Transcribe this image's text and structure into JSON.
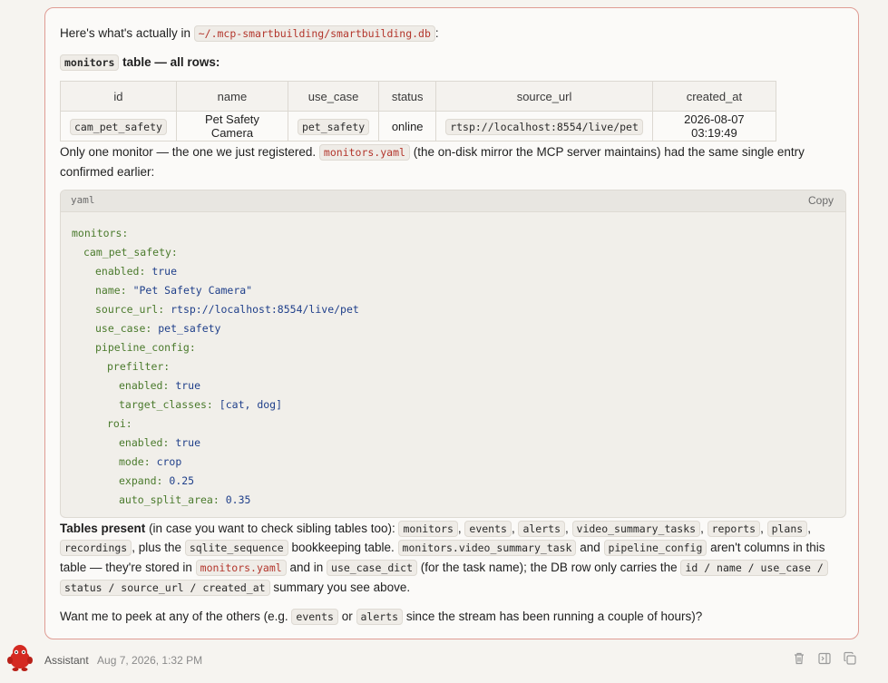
{
  "message": {
    "intro_text": "Here's what's actually in",
    "db_path": "~/.mcp-smartbuilding/smartbuilding.db",
    "colon": ":",
    "table_code": "monitors",
    "table_heading": "table — all rows:",
    "table": {
      "headers": [
        "id",
        "name",
        "use_case",
        "status",
        "source_url",
        "created_at"
      ],
      "rows": [
        [
          "cam_pet_safety",
          "Pet Safety Camera",
          "pet_safety",
          "online",
          "rtsp://localhost:8554/live/pet",
          "2026-08-07 03:19:49"
        ]
      ]
    },
    "para1_a": "Only one monitor — the one we just registered.",
    "para1_code": "monitors.yaml",
    "para1_b": "(the on-disk mirror the MCP server maintains) had the same single entry",
    "para1_c": "confirmed earlier:",
    "codeblock": {
      "lang": "yaml",
      "copy_label": "Copy",
      "lines": [
        {
          "indent": 0,
          "key": "monitors:",
          "val": ""
        },
        {
          "indent": 1,
          "key": "cam_pet_safety:",
          "val": ""
        },
        {
          "indent": 2,
          "key": "enabled:",
          "val": "true"
        },
        {
          "indent": 2,
          "key": "name:",
          "val": "\"Pet Safety Camera\""
        },
        {
          "indent": 2,
          "key": "source_url:",
          "val": "rtsp://localhost:8554/live/pet"
        },
        {
          "indent": 2,
          "key": "use_case:",
          "val": "pet_safety"
        },
        {
          "indent": 2,
          "key": "pipeline_config:",
          "val": ""
        },
        {
          "indent": 3,
          "key": "prefilter:",
          "val": ""
        },
        {
          "indent": 4,
          "key": "enabled:",
          "val": "true"
        },
        {
          "indent": 4,
          "key": "target_classes:",
          "val": "[cat, dog]"
        },
        {
          "indent": 3,
          "key": "roi:",
          "val": ""
        },
        {
          "indent": 4,
          "key": "enabled:",
          "val": "true"
        },
        {
          "indent": 4,
          "key": "mode:",
          "val": "crop"
        },
        {
          "indent": 4,
          "key": "expand:",
          "val": "0.25"
        },
        {
          "indent": 4,
          "key": "auto_split_area:",
          "val": "0.35"
        }
      ]
    },
    "tables_bold": "Tables present",
    "tables_text": "(in case you want to check sibling tables too):",
    "sibling_tables": [
      "monitors",
      "events",
      "alerts",
      "video_summary_tasks",
      "reports",
      "plans",
      "recordings"
    ],
    "plus_the": ", plus the",
    "sqlite_seq": "sqlite_sequence",
    "bookkeeping": "bookkeeping table.",
    "col_a": "monitors.video_summary_task",
    "and1": "and",
    "col_b": "pipeline_config",
    "arent": "aren't columns in this",
    "line3_a": "table — they're stored in",
    "line3_code1": "monitors.yaml",
    "line3_b": "and in",
    "line3_code2": "use_case_dict",
    "line3_c": "(for the task name); the DB row only carries the",
    "line3_code3": "id / name / use_case /",
    "line4_code": "status / source_url / created_at",
    "line4_text": "summary you see above.",
    "q_a": "Want me to peek at any of the others (e.g.",
    "q_code1": "events",
    "q_or": "or",
    "q_code2": "alerts",
    "q_b": "since the stream has been running a couple of hours)?"
  },
  "footer": {
    "sender": "Assistant",
    "timestamp": "Aug 7, 2026, 1:32 PM",
    "icons": [
      "trash-icon",
      "split-view-icon",
      "copy-icon"
    ]
  },
  "colors": {
    "accent_border": "#df9c94",
    "code_red": "#b3362c",
    "avatar_red": "#d42a22"
  }
}
